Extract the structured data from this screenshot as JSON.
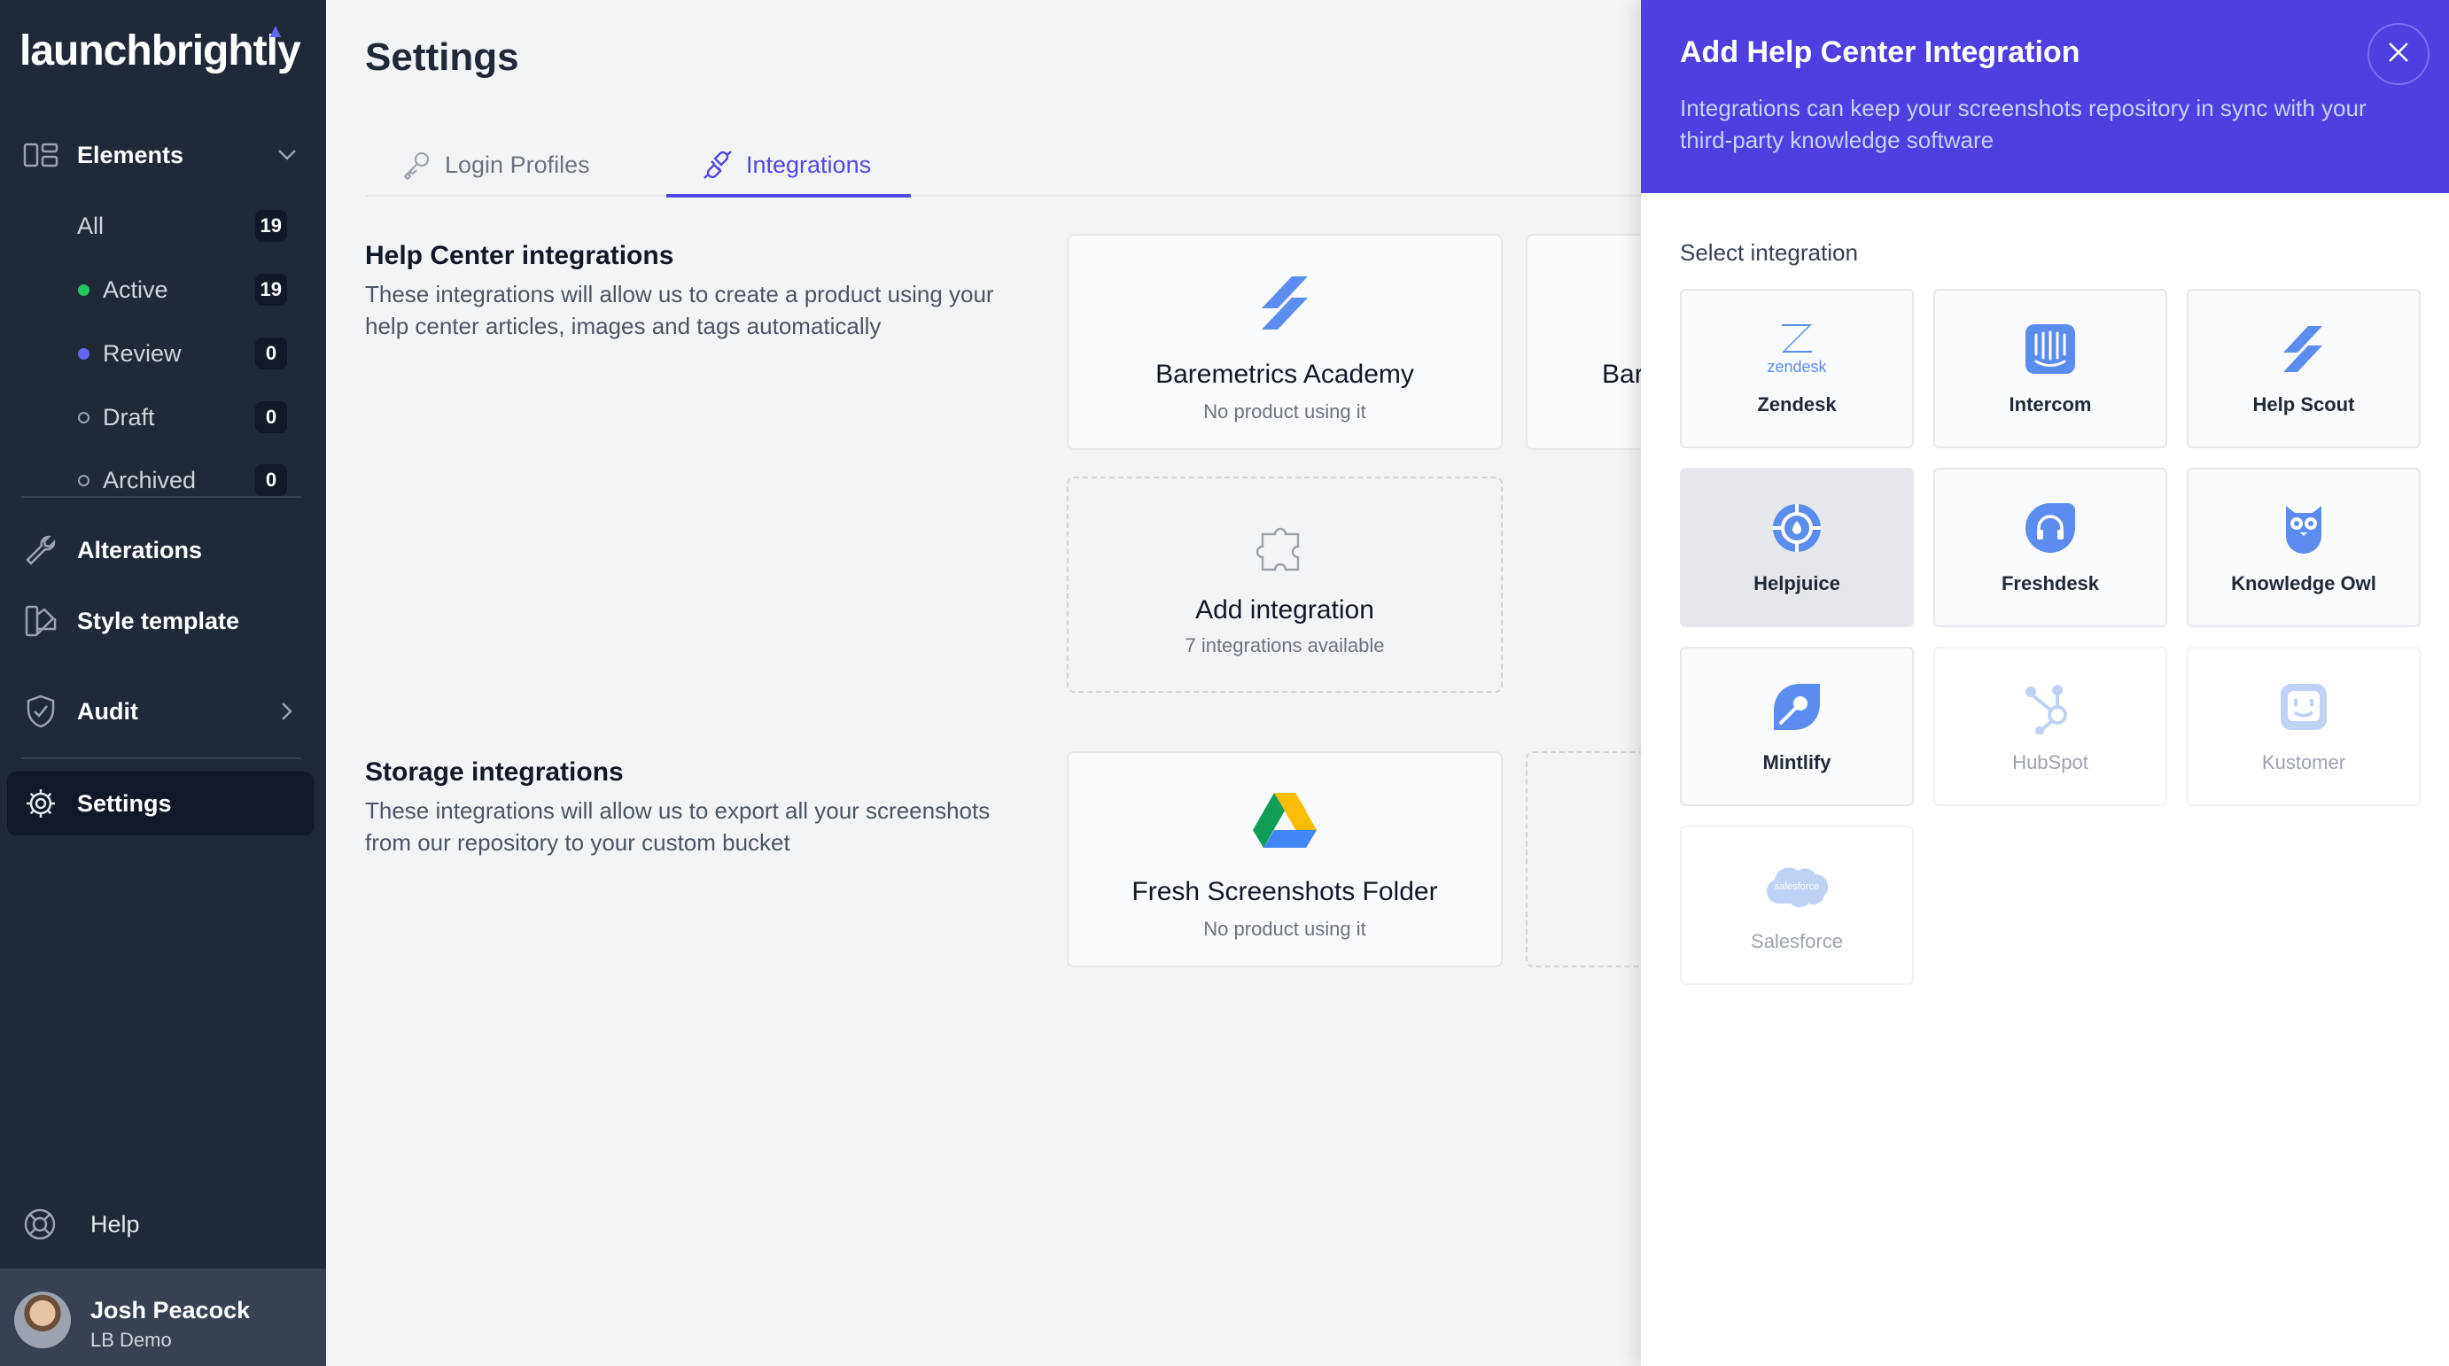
{
  "app": {
    "logo": "launchbrightly"
  },
  "sidebar": {
    "elements_label": "Elements",
    "sub_items": [
      {
        "label": "All",
        "count": "19",
        "dot": ""
      },
      {
        "label": "Active",
        "count": "19",
        "dot": "#22c55e"
      },
      {
        "label": "Review",
        "count": "0",
        "dot": "#6366f1"
      },
      {
        "label": "Draft",
        "count": "0",
        "dot": "outline"
      },
      {
        "label": "Archived",
        "count": "0",
        "dot": "outline"
      }
    ],
    "alterations_label": "Alterations",
    "style_template_label": "Style template",
    "audit_label": "Audit",
    "settings_label": "Settings",
    "help_label": "Help",
    "user": {
      "name": "Josh Peacock",
      "org": "LB Demo"
    }
  },
  "main": {
    "title": "Settings",
    "tabs": [
      {
        "label": "Login Profiles",
        "icon": "key-icon",
        "active": false
      },
      {
        "label": "Integrations",
        "icon": "plug-icon",
        "active": true
      }
    ],
    "help_center": {
      "title": "Help Center integrations",
      "description": "These integrations will allow us to create a product using your help center articles, images and tags automatically",
      "cards": [
        {
          "title": "Baremetrics Academy",
          "subtitle": "No product using it",
          "icon": "helpscout-icon"
        },
        {
          "title": "Bar",
          "subtitle": "",
          "icon": ""
        },
        {
          "title": "Add integration",
          "subtitle": "7 integrations available",
          "icon": "puzzle-icon"
        }
      ]
    },
    "storage": {
      "title": "Storage integrations",
      "description": "These integrations will allow us to export all your screenshots from our repository to your custom bucket",
      "cards": [
        {
          "title": "Fresh Screenshots Folder",
          "subtitle": "No product using it",
          "icon": "google-drive-icon"
        }
      ]
    }
  },
  "panel": {
    "title": "Add Help Center Integration",
    "subtitle": "Integrations can keep your screenshots repository in sync with your third-party knowledge software",
    "select_label": "Select integration",
    "integrations": [
      {
        "label": "Zendesk",
        "icon": "zendesk-icon",
        "state": "enabled",
        "wordmark": "zendesk"
      },
      {
        "label": "Intercom",
        "icon": "intercom-icon",
        "state": "enabled"
      },
      {
        "label": "Help Scout",
        "icon": "helpscout-icon",
        "state": "enabled"
      },
      {
        "label": "Helpjuice",
        "icon": "helpjuice-icon",
        "state": "hover"
      },
      {
        "label": "Freshdesk",
        "icon": "freshdesk-icon",
        "state": "enabled"
      },
      {
        "label": "Knowledge Owl",
        "icon": "owl-icon",
        "state": "enabled"
      },
      {
        "label": "Mintlify",
        "icon": "mintlify-icon",
        "state": "enabled"
      },
      {
        "label": "HubSpot",
        "icon": "hubspot-icon",
        "state": "disabled"
      },
      {
        "label": "Kustomer",
        "icon": "kustomer-icon",
        "state": "disabled"
      },
      {
        "label": "Salesforce",
        "icon": "salesforce-icon",
        "state": "disabled",
        "wordmark": "salesforce"
      }
    ]
  },
  "colors": {
    "accent": "#4f46e5",
    "panel_header": "#4f3ee0",
    "sidebar": "#1f2937",
    "icon_blue": "#5b8def"
  }
}
